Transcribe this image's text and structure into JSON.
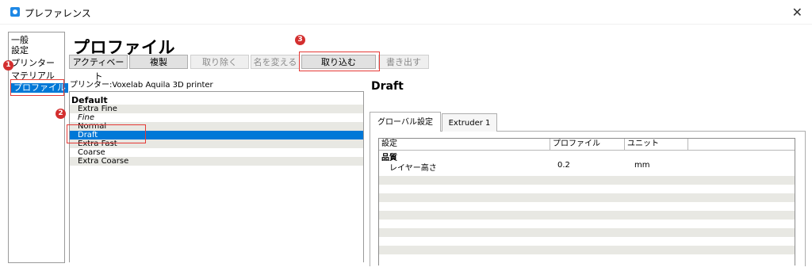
{
  "window": {
    "title": "プレファレンス"
  },
  "sidebar": {
    "items": [
      "一般",
      "設定",
      "プリンター",
      "マテリアル",
      "プロファイル"
    ]
  },
  "page": {
    "heading": "プロファイル"
  },
  "toolbar": {
    "activate": "アクティベート",
    "duplicate": "複製",
    "remove": "取り除く",
    "rename": "名を変える",
    "import": "取り込む",
    "export": "書き出す"
  },
  "printer_label": "プリンター:Voxelab Aquila 3D printer",
  "profiles": {
    "group": "Default",
    "items": [
      "Extra Fine",
      "Fine",
      "Normal",
      "Draft",
      "Extra Fast",
      "Coarse",
      "Extra Coarse"
    ],
    "selected": "Draft"
  },
  "detail": {
    "title": "Draft",
    "tabs": [
      "グローバル設定",
      "Extruder 1"
    ],
    "columns": [
      "設定",
      "プロファイル",
      "ユニット"
    ],
    "section": "品質",
    "rows": [
      {
        "setting": "レイヤー高さ",
        "profile": "0.2",
        "unit": "mm"
      }
    ]
  },
  "annotations": {
    "badge1": "1",
    "badge2": "2",
    "badge3": "3"
  },
  "colors": {
    "selection": "#0078d7",
    "annotation": "#e53935",
    "alt_row": "#e8e8e3"
  }
}
